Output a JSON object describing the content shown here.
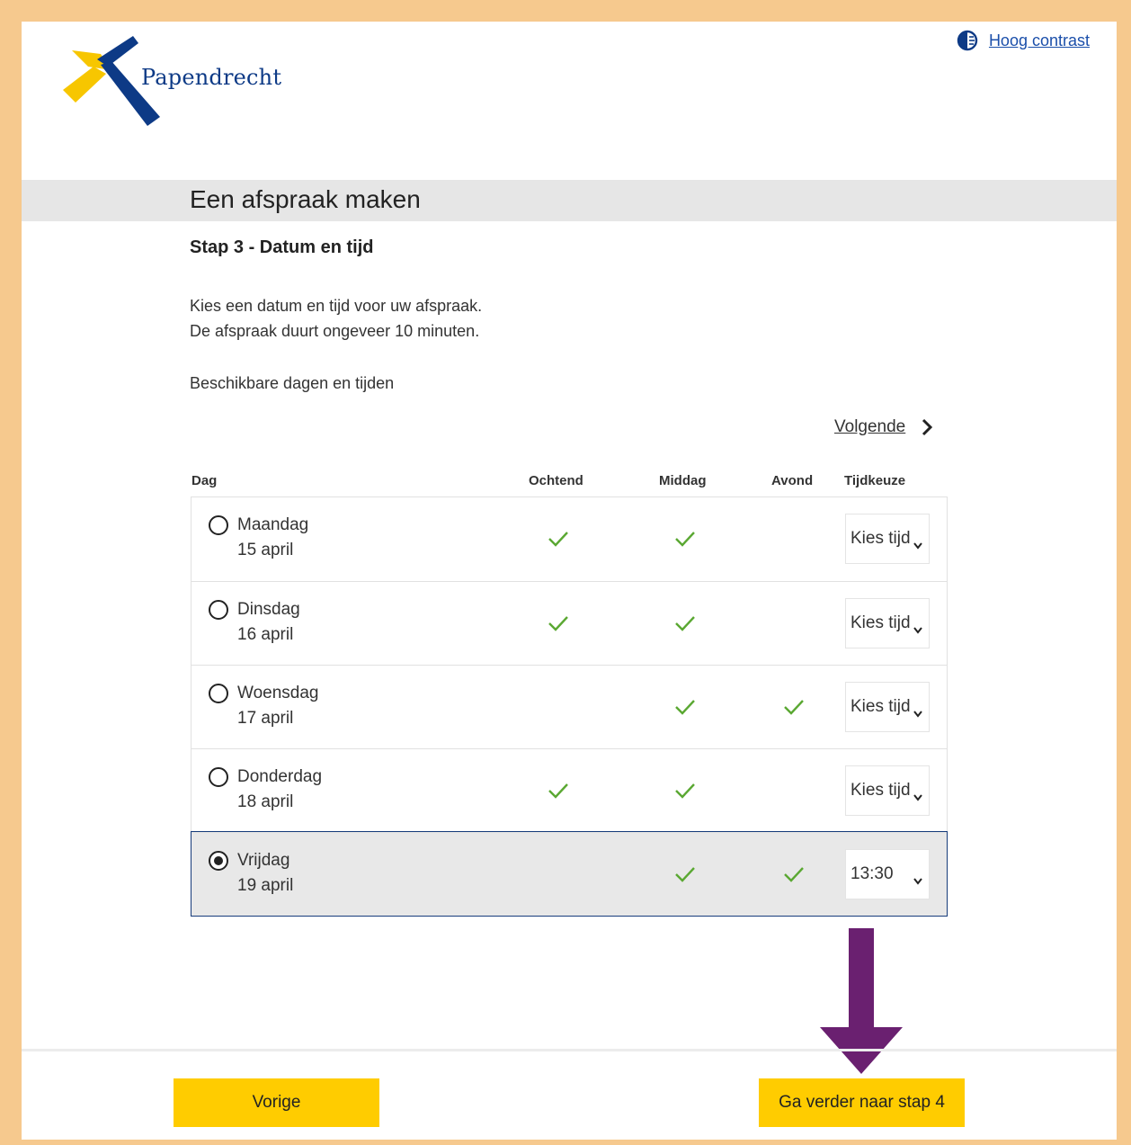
{
  "header": {
    "logo_text": "Papendrecht",
    "contrast_link": "Hoog contrast"
  },
  "page": {
    "title": "Een afspraak maken",
    "step": "Stap 3 - Datum en tijd",
    "intro_line1": "Kies een datum en tijd voor uw afspraak.",
    "intro_line2": "De afspraak duurt ongeveer 10 minuten.",
    "available_label": "Beschikbare dagen en tijden",
    "next_link": "Volgende"
  },
  "table": {
    "headers": {
      "day": "Dag",
      "morning": "Ochtend",
      "afternoon": "Middag",
      "evening": "Avond",
      "time": "Tijdkeuze"
    },
    "rows": [
      {
        "day": "Maandag",
        "date": "15 april",
        "morning": true,
        "afternoon": true,
        "evening": false,
        "time": "Kies tijd",
        "selected": false
      },
      {
        "day": "Dinsdag",
        "date": "16 april",
        "morning": true,
        "afternoon": true,
        "evening": false,
        "time": "Kies tijd",
        "selected": false
      },
      {
        "day": "Woensdag",
        "date": "17 april",
        "morning": false,
        "afternoon": true,
        "evening": true,
        "time": "Kies tijd",
        "selected": false
      },
      {
        "day": "Donderdag",
        "date": "18 april",
        "morning": true,
        "afternoon": true,
        "evening": false,
        "time": "Kies tijd",
        "selected": false
      },
      {
        "day": "Vrijdag",
        "date": "19 april",
        "morning": false,
        "afternoon": true,
        "evening": true,
        "time": "13:30",
        "selected": true
      }
    ]
  },
  "footer": {
    "prev_label": "Vorige",
    "next_label": "Ga verder naar stap 4"
  },
  "colors": {
    "accent_yellow": "#ffcc00",
    "brand_blue": "#0d3a86",
    "check_green": "#5aa832",
    "arrow_purple": "#6a2070",
    "frame": "#f6c98e"
  }
}
